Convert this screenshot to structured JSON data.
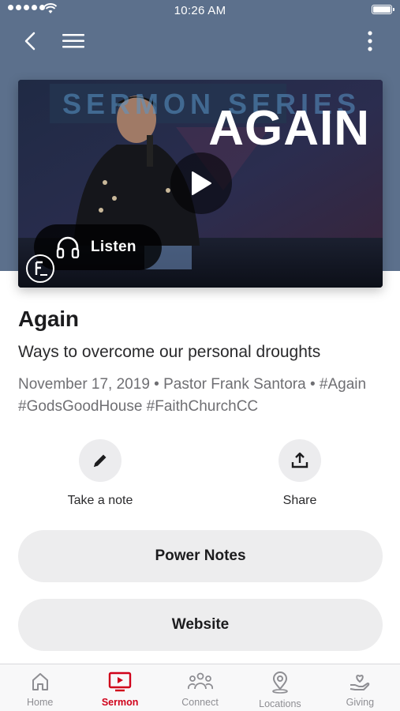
{
  "status_bar": {
    "time": "10:26 AM"
  },
  "video": {
    "thumbnail_series_text": "SERMON SERIES",
    "thumbnail_title": "AGAIN",
    "listen_label": "Listen"
  },
  "sermon": {
    "title": "Again",
    "subtitle": "Ways to overcome our personal droughts",
    "meta": "November 17, 2019 • Pastor Frank Santora • #Again #GodsGoodHouse #FaithChurchCC"
  },
  "actions": {
    "note_label": "Take a note",
    "share_label": "Share"
  },
  "buttons": {
    "power_notes": "Power Notes",
    "website": "Website"
  },
  "tab_bar": {
    "tabs": [
      {
        "label": "Home",
        "icon": "home-icon"
      },
      {
        "label": "Sermon",
        "icon": "tv-play-icon",
        "active": true
      },
      {
        "label": "Connect",
        "icon": "people-icon"
      },
      {
        "label": "Locations",
        "icon": "map-pin-icon"
      },
      {
        "label": "Giving",
        "icon": "hand-heart-icon"
      }
    ]
  },
  "colors": {
    "header": "#5c708c",
    "accent": "#d0021b",
    "pill": "#ededee"
  }
}
